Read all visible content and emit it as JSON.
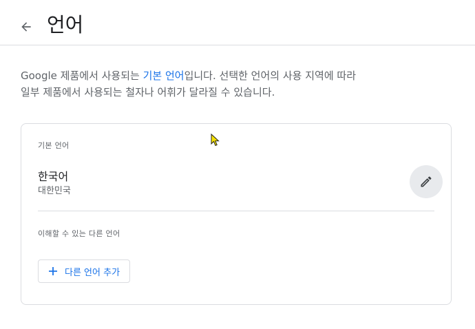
{
  "header": {
    "title": "언어"
  },
  "description": {
    "part1": "Google 제품에서 사용되는 ",
    "link": "기본 언어",
    "part2": "입니다. 선택한 언어의 사용 지역에 따라",
    "line2": "일부 제품에서 사용되는 철자나 어휘가 달라질 수 있습니다."
  },
  "primary_language": {
    "section_label": "기본 언어",
    "name": "한국어",
    "region": "대한민국"
  },
  "other_languages": {
    "section_label": "이해할 수 있는 다른 언어",
    "add_button_label": "다른 언어 추가"
  },
  "colors": {
    "accent": "#1a73e8",
    "text_primary": "#202124",
    "text_secondary": "#5f6368",
    "border": "#dadce0"
  }
}
